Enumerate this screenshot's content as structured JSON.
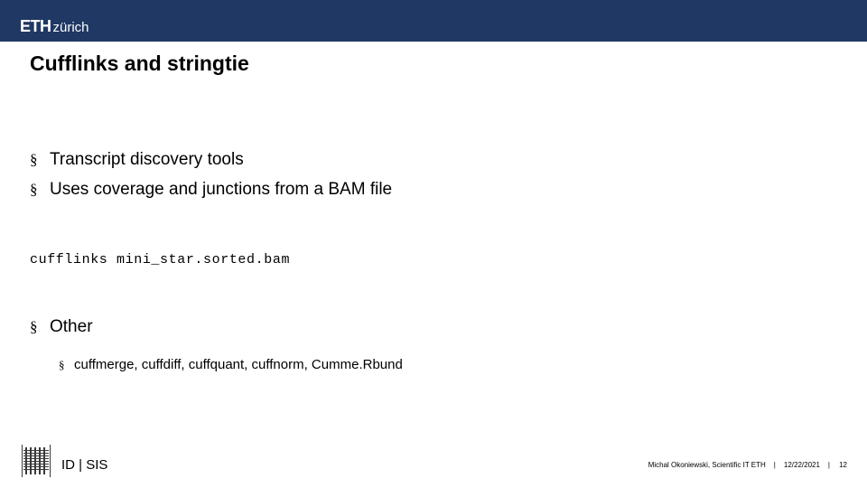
{
  "header": {
    "logo_main": "ETH",
    "logo_sub": "zürich",
    "bar_color": "#1f3864"
  },
  "slide": {
    "title": "Cufflinks and stringtie",
    "bullets_level1": [
      {
        "marker": "§",
        "text": "Transcript discovery tools"
      },
      {
        "marker": "§",
        "text": "Uses coverage and junctions from a BAM file"
      }
    ],
    "code": "cufflinks mini_star.sorted.bam",
    "other_bullet": {
      "marker": "§",
      "text": "Other"
    },
    "bullets_level2": [
      {
        "marker": "§",
        "text": "cuffmerge, cuffdiff, cuffquant, cuffnorm, Cumme.Rbund"
      }
    ]
  },
  "footer": {
    "department": "ID | SIS",
    "author": "Michal Okoniewski, Scientific IT ETH",
    "separator": "|",
    "date": "12/22/2021",
    "page_number": "12"
  }
}
